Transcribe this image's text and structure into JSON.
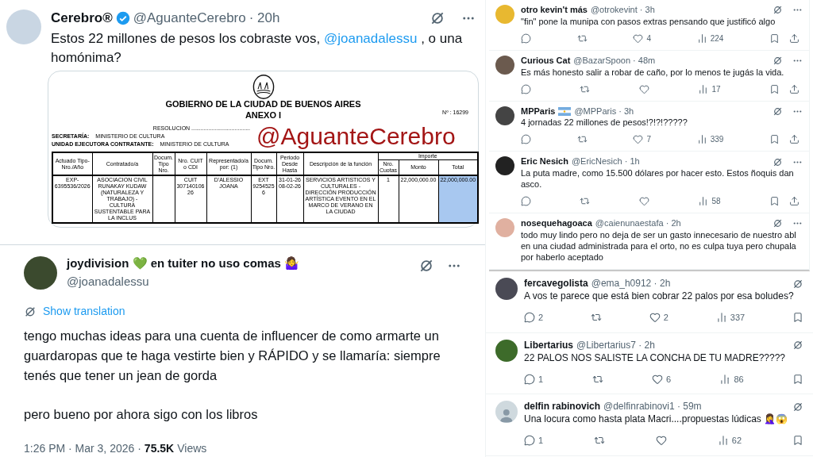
{
  "main_tweet": {
    "name": "Cerebro®",
    "verified": true,
    "handle": "@AguanteCerebro",
    "time": "· 20h",
    "text_before": "Estos 22 millones de pesos los cobraste vos,",
    "mention": "@joanadalessu",
    "text_after": ", o una homónima?",
    "document": {
      "title": "GOBIERNO DE LA CIUDAD DE BUENOS AIRES",
      "subtitle": "ANEXO I",
      "number": "Nº : 16299",
      "resolution": "RESOLUCION ......................................",
      "watermark": "@AguanteCerebro",
      "fields": [
        {
          "label": "SECRETARÍA:",
          "value": "MINISTERIO DE CULTURA"
        },
        {
          "label": "UNIDAD EJECUTORA CONTRATANTE:",
          "value": "MINISTERIO DE CULTURA"
        }
      ],
      "group_header": "Importe",
      "columns": [
        "Actuado Tipo-Nro./Año",
        "Contratado/a",
        "Docum. Tipo Nro.",
        "Nro. CUIT o CDI",
        "Representado/a por: (1)",
        "Docum. Tipo Nro.",
        "Periodo Desde Hasta",
        "Descripción de la función"
      ],
      "group_columns": [
        "Nro. Cuotas",
        "Monto",
        "Total"
      ],
      "row": [
        {
          "text": "EXP-6395536/2026",
          "selected": false
        },
        {
          "text": "ASOCIACION CIVIL RUNAKAY KUDAW (NATURALEZA Y TRABAJO) - CULTURA SUSTENTABLE PARA LA INCLUS",
          "selected": false
        },
        {
          "selected": false
        },
        {
          "text": "CUIT 30714010626",
          "selected": false
        },
        {
          "text": "D'ALESSIO JOANA",
          "selected": false
        },
        {
          "text": "EXT 92545256",
          "selected": false
        },
        {
          "text": "31-01-26 08-02-26",
          "selected": false
        },
        {
          "text": "SERVICIOS ARTISTICOS Y CULTURALES - DIRECCIÓN PRODUCCIÓN ARTÍSTICA EVENTO EN EL MARCO DE VERANO EN LA CIUDAD",
          "selected": false
        },
        {
          "text": "1",
          "selected": false
        },
        {
          "text": "22,000,000.00",
          "selected": false
        },
        {
          "text": "22,000,000.00",
          "selected": true
        }
      ]
    }
  },
  "quoted_tweet": {
    "name": "joydivision 💚 en tuiter no uso comas 🤷‍♀️",
    "handle": "@joanadalessu",
    "translate": "Show translation",
    "paragraphs": [
      "tengo muchas ideas para una cuenta de influencer de como armarte un guardaropas que te haga vestirte bien y RÁPIDO y se llamaría: siempre tenés que tener un jean de gorda",
      "pero bueno por ahora sigo con los libros"
    ],
    "time": "1:26 PM · Mar 3, 2026 ·",
    "views": "75.5K",
    "views_label": "Views"
  },
  "replies_top": [
    {
      "name": "otro kevin't más",
      "flag": false,
      "handle": "@otrokevint · 3h",
      "text": "\"fin\" pone la munipa con pasos extras pensando que justificó algo",
      "likes": "4",
      "views": "224",
      "actions": true
    },
    {
      "name": "Curious Cat",
      "flag": false,
      "handle": "@BazarSpoon · 48m",
      "text": "Es más honesto salir a robar de caño, por lo menos te jugás la vida.",
      "views": "17",
      "actions": true
    },
    {
      "name": "MPParis",
      "flag": true,
      "handle": "@MPParis · 3h",
      "text": "4 jornadas 22 millones de pesos!?!?!?????",
      "likes": "7",
      "views": "339",
      "actions": true
    },
    {
      "name": "Eric Nesich",
      "flag": false,
      "handle": "@EricNesich · 1h",
      "text": "La puta madre, como 15.500 dólares por hacer esto. Estos ñoquis dan asco.",
      "views": "58",
      "actions": true
    },
    {
      "name": "nosequehagoaca",
      "flag": false,
      "handle": "@caienunaestafa · 2h",
      "text": "todo muy lindo pero no deja de ser un gasto innecesario de nuestro abl en una ciudad administrada para el orto, no es culpa tuya pero chupala por haberlo aceptado",
      "actions": false
    }
  ],
  "replies_bottom": [
    {
      "name": "fercavegolista",
      "handle": "@ema_h0912 · 2h",
      "text": "A vos te parece que está bien cobrar 22 palos por esa boludes?",
      "replies": "2",
      "likes": "2",
      "views": "337",
      "default_avatar": false
    },
    {
      "name": "Libertarius",
      "handle": "@Libertarius7 · 2h",
      "text": "22 PALOS NOS SALISTE LA CONCHA DE TU MADRE?????",
      "replies": "1",
      "likes": "6",
      "views": "86",
      "default_avatar": false
    },
    {
      "name": "delfin rabinovich",
      "handle": "@delfinrabinovi1 · 59m",
      "text": "Una locura como hasta plata Macri....propuestas lúdicas 🤦‍♀️😱",
      "replies": "1",
      "views": "62",
      "default_avatar": true
    }
  ]
}
